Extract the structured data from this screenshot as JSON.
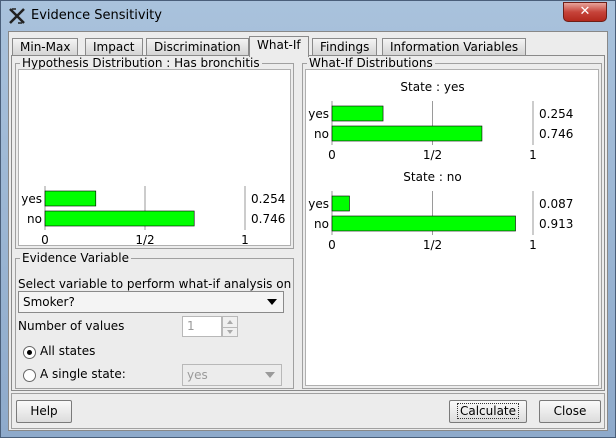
{
  "window": {
    "title": "Evidence Sensitivity",
    "close_label": "✕"
  },
  "tabs": [
    {
      "label": "Min-Max"
    },
    {
      "label": "Impact"
    },
    {
      "label": "Discrimination"
    },
    {
      "label": "What-If"
    },
    {
      "label": "Findings"
    },
    {
      "label": "Information Variables"
    }
  ],
  "active_tab": "What-If",
  "hypothesis": {
    "legend": "Hypothesis Distribution : Has bronchitis",
    "chart": {
      "type": "bar",
      "categories": [
        "yes",
        "no"
      ],
      "values": [
        0.254,
        0.746
      ],
      "value_labels": [
        "0.254",
        "0.746"
      ],
      "ticks": [
        "0",
        "1/2",
        "1"
      ],
      "xlim": [
        0,
        1
      ]
    }
  },
  "evidence": {
    "legend": "Evidence Variable",
    "instruction": "Select variable to perform what-if analysis on",
    "selected_variable": "Smoker?",
    "num_values_label": "Number of values",
    "num_values": "1",
    "all_states_label": "All states",
    "single_state_label": "A single state:",
    "single_state_value": "yes",
    "all_states_checked": true
  },
  "whatif": {
    "legend": "What-If Distributions",
    "charts": [
      {
        "title": "State : yes"
      },
      {
        "title": "State : no"
      }
    ]
  },
  "chart_data": [
    {
      "type": "bar",
      "title": "Hypothesis Distribution : Has bronchitis",
      "categories": [
        "yes",
        "no"
      ],
      "values": [
        0.254,
        0.746
      ],
      "xlim": [
        0,
        1
      ]
    },
    {
      "type": "bar",
      "title": "State : yes",
      "categories": [
        "yes",
        "no"
      ],
      "values": [
        0.254,
        0.746
      ],
      "xlim": [
        0,
        1
      ]
    },
    {
      "type": "bar",
      "title": "State : no",
      "categories": [
        "yes",
        "no"
      ],
      "values": [
        0.087,
        0.913
      ],
      "xlim": [
        0,
        1
      ]
    }
  ],
  "whatif_value_labels": [
    [
      "0.254",
      "0.746"
    ],
    [
      "0.087",
      "0.913"
    ]
  ],
  "buttons": {
    "help": "Help",
    "calculate": "Calculate",
    "close": "Close"
  },
  "colors": {
    "bar": "#00ff00",
    "bar_border": "#000000",
    "grid": "#9a9a9a"
  }
}
